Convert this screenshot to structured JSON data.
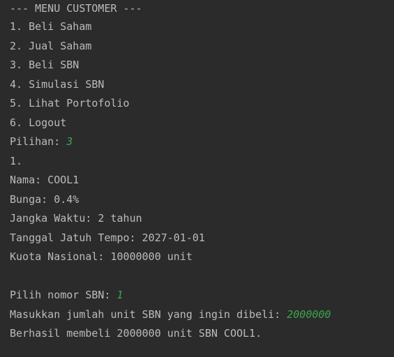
{
  "console": {
    "header": "--- MENU CUSTOMER ---",
    "menu_items": [
      "1. Beli Saham",
      "2. Jual Saham",
      "3. Beli SBN",
      "4. Simulasi SBN",
      "5. Lihat Portofolio",
      "6. Logout"
    ],
    "choice_prompt": "Pilihan: ",
    "choice_value": "3",
    "sbn_index": "1.",
    "sbn_name": "Nama: COOL1",
    "sbn_rate": "Bunga: 0.4%",
    "sbn_term": "Jangka Waktu: 2 tahun",
    "sbn_maturity": "Tanggal Jatuh Tempo: 2027-01-01",
    "sbn_quota": "Kuota Nasional: 10000000 unit",
    "sbn_select_prompt": "Pilih nomor SBN: ",
    "sbn_select_value": "1",
    "units_prompt": "Masukkan jumlah unit SBN yang ingin dibeli: ",
    "units_value": "2000000",
    "result_message": "Berhasil membeli 2000000 unit SBN COOL1."
  },
  "colors": {
    "background": "#2b2b2b",
    "text": "#bbbbbb",
    "user_input": "#3fa34d"
  }
}
